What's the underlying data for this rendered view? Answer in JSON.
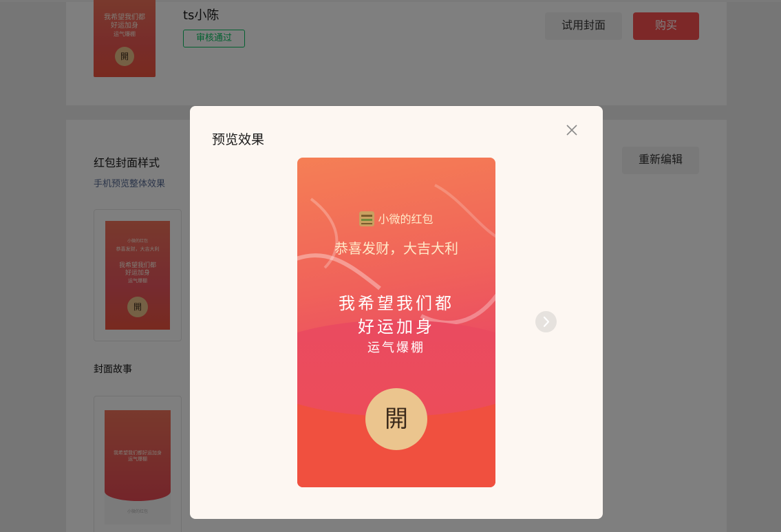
{
  "cover": {
    "name": "ts小陈",
    "status": "审核通过",
    "thumb_text": "我希望我们都\n好运加身\n运气爆棚",
    "open_char": "開"
  },
  "actions": {
    "try_label": "试用封面",
    "buy_label": "购买",
    "reedit_label": "重新编辑"
  },
  "section": {
    "title": "红包封面样式",
    "subtitle": "手机预览整体效果",
    "story_title": "封面故事"
  },
  "modal": {
    "title": "预览效果",
    "sender": "小微的红包",
    "blessing": "恭喜发财，大吉大利",
    "line1": "我希望我们都",
    "line2": "好运加身",
    "line3": "运气爆棚",
    "open_char": "開"
  },
  "colors": {
    "accent_red": "#fa5151",
    "success_green": "#07c160",
    "link_blue": "#576b95",
    "open_gold": "#ebc58e"
  },
  "icons": {
    "close": "close-icon",
    "next": "chevron-right-icon"
  }
}
